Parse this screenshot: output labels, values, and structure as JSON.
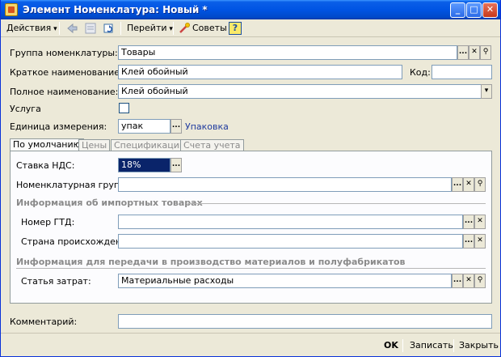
{
  "window": {
    "title": "Элемент Номенклатура: Новый *",
    "min_glyph": "_",
    "max_glyph": "□",
    "close_glyph": "✕"
  },
  "toolbar": {
    "actions_label": "Действия",
    "goto_label": "Перейти",
    "tips_label": "Советы",
    "help_label": "?"
  },
  "form": {
    "group_label": "Группа номенклатуры:",
    "group_value": "Товары",
    "short_name_label": "Краткое наименование:",
    "short_name_value": "Клей обойный",
    "code_label": "Код:",
    "code_value": "",
    "full_name_label": "Полное наименование:",
    "full_name_value": "Клей обойный",
    "service_label": "Услуга",
    "service_checked": false,
    "unit_label": "Единица измерения:",
    "unit_value": "упак",
    "unit_link": "Упаковка",
    "comment_label": "Комментарий:",
    "comment_value": ""
  },
  "tabs": [
    {
      "label": "По умолчанию",
      "active": true
    },
    {
      "label": "Цены",
      "active": false
    },
    {
      "label": "Спецификации",
      "active": false
    },
    {
      "label": "Счета учета",
      "active": false
    }
  ],
  "tab_default": {
    "vat_label": "Ставка НДС:",
    "vat_value": "18%",
    "nom_group_label": "Номенклатурная группа:",
    "nom_group_value": "",
    "import_section": "Информация об импортных товарах",
    "gtd_label": "Номер ГТД:",
    "gtd_value": "",
    "country_label": "Страна происхождения:",
    "country_value": "",
    "production_section": "Информация для передачи в производство материалов и полуфабрикатов",
    "cost_item_label": "Статья затрат:",
    "cost_item_value": "Материальные расходы"
  },
  "buttons": {
    "ok": "OK",
    "save": "Записать",
    "close": "Закрыть",
    "ellipsis": "...",
    "clear": "✕",
    "search": "⚲",
    "dropdown": "▾"
  },
  "colors": {
    "titlebar": "#0054e3",
    "window_bg": "#ece9d8",
    "link": "#1e3a9e",
    "selection": "#0a246a"
  }
}
